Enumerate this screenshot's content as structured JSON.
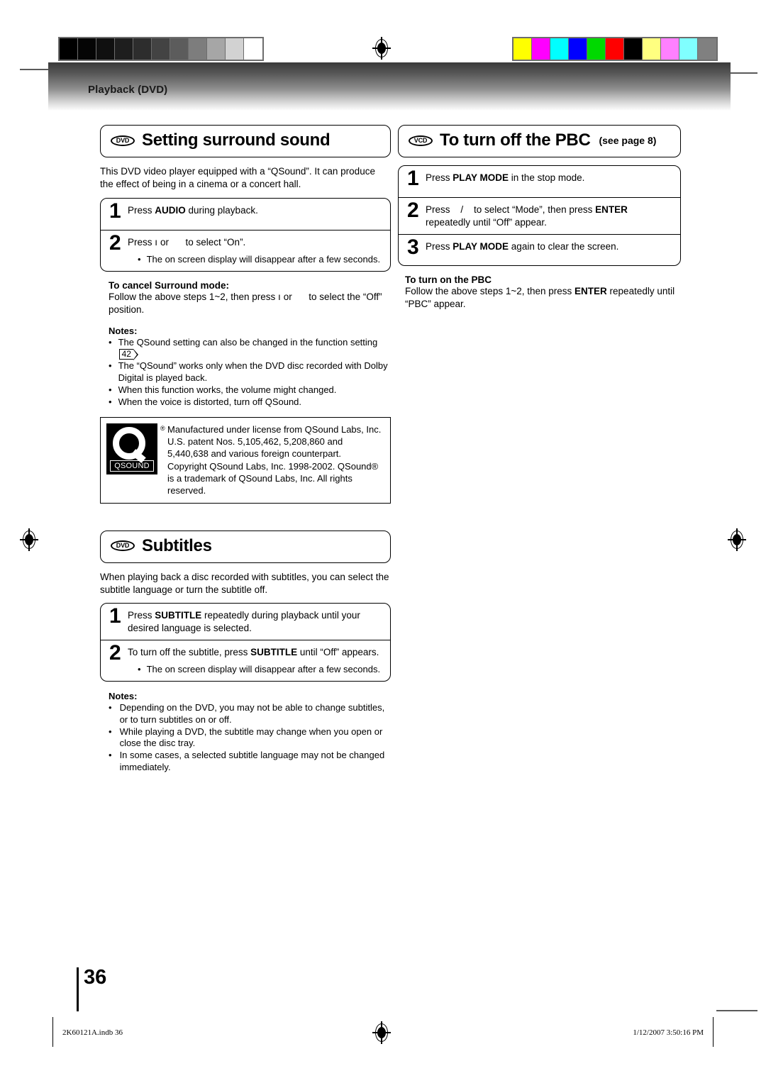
{
  "header": {
    "running_title": "Playback (DVD)"
  },
  "calibration": {
    "gray_swatches": [
      "#000000",
      "#050505",
      "#101010",
      "#1e1e1e",
      "#2d2d2d",
      "#434343",
      "#5c5c5c",
      "#7d7d7d",
      "#a6a6a6",
      "#d2d2d2",
      "#ffffff"
    ],
    "color_swatches": [
      "#ffff00",
      "#ff00ff",
      "#00ffff",
      "#0000ff",
      "#00d900",
      "#ff0000",
      "#000000",
      "#ffff80",
      "#ff80ff",
      "#80ffff",
      "#808080"
    ]
  },
  "left_column": {
    "section": {
      "badge": "DVD",
      "title": "Setting surround sound"
    },
    "lead": "This DVD video player equipped with a “QSound”. It can produce the effect of being in a cinema or a concert hall.",
    "steps": [
      {
        "num": "1",
        "text_before": "Press ",
        "bold": "AUDIO",
        "text_after": " during playback."
      },
      {
        "num": "2",
        "text_before": "Press ",
        "glyph_a": "ı",
        "mid": " or ",
        "text_after": " to select “On”.",
        "bullet": "The on screen display will disappear after a few seconds."
      }
    ],
    "cancel": {
      "heading": "To cancel Surround mode:",
      "body_a": "Follow the above steps 1~2, then press ",
      "glyph": "ı",
      "body_b": " or ",
      "body_c": " to select the “Off” position."
    },
    "notes_title": "Notes:",
    "notes": [
      {
        "a": "The QSound setting can also be changed in the function setting ",
        "ref": "42",
        "b": "."
      },
      {
        "a": "The “QSound” works only when the DVD disc recorded with Dolby Digital is played back."
      },
      {
        "a": "When this function works, the volume might changed."
      },
      {
        "a": "When the voice is distorted, turn off QSound."
      }
    ],
    "license": {
      "logo_word": "QSOUND",
      "logo_reg": "®",
      "text": "Manufactured under license from QSound Labs, Inc. U.S. patent Nos. 5,105,462, 5,208,860 and 5,440,638 and various foreign counterpart. Copyright QSound Labs, Inc. 1998-2002. QSound® is a trademark of QSound Labs, Inc. All rights reserved."
    },
    "section2": {
      "badge": "DVD",
      "title": "Subtitles"
    },
    "lead2": "When playing back a disc recorded with subtitles, you can select the subtitle language or turn the subtitle off.",
    "steps2": [
      {
        "num": "1",
        "text_before": "Press ",
        "bold": "SUBTITLE",
        "text_after": " repeatedly during playback until your desired language is selected."
      },
      {
        "num": "2",
        "text_before": "To turn off the subtitle, press ",
        "bold": "SUBTITLE",
        "text_after": " until “Off” appears.",
        "bullet": "The on screen display will disappear after a few seconds."
      }
    ],
    "notes_title2": "Notes:",
    "notes2": [
      "Depending on the DVD, you may not be able to change subtitles, or to turn subtitles on or off.",
      "While playing a DVD, the subtitle may change when you open or close the disc tray.",
      "In some cases, a selected subtitle language may not be changed immediately."
    ]
  },
  "right_column": {
    "section": {
      "badge": "VCD",
      "title": "To turn off the PBC",
      "suffix": "(see page 8)"
    },
    "steps": [
      {
        "num": "1",
        "text_before": "Press ",
        "bold": "PLAY MODE",
        "text_after": " in the stop mode."
      },
      {
        "num": "2",
        "text_before": "Press ",
        "slash": "/",
        "mid": " to select “Mode”, then press ",
        "bold": "ENTER",
        "text_after": " repeatedly until “Off” appear."
      },
      {
        "num": "3",
        "text_before": "Press ",
        "bold": "PLAY MODE",
        "text_after": " again to clear the screen."
      }
    ],
    "turn_on": {
      "heading": "To turn on the PBC",
      "body_a": "Follow the above steps 1~2, then press ",
      "bold": "ENTER",
      "body_b": " repeatedly until “PBC” appear."
    }
  },
  "page_number": "36",
  "footer": {
    "left": "2K60121A.indb   36",
    "right": "1/12/2007   3:50:16 PM"
  },
  "bullet_char": "•"
}
